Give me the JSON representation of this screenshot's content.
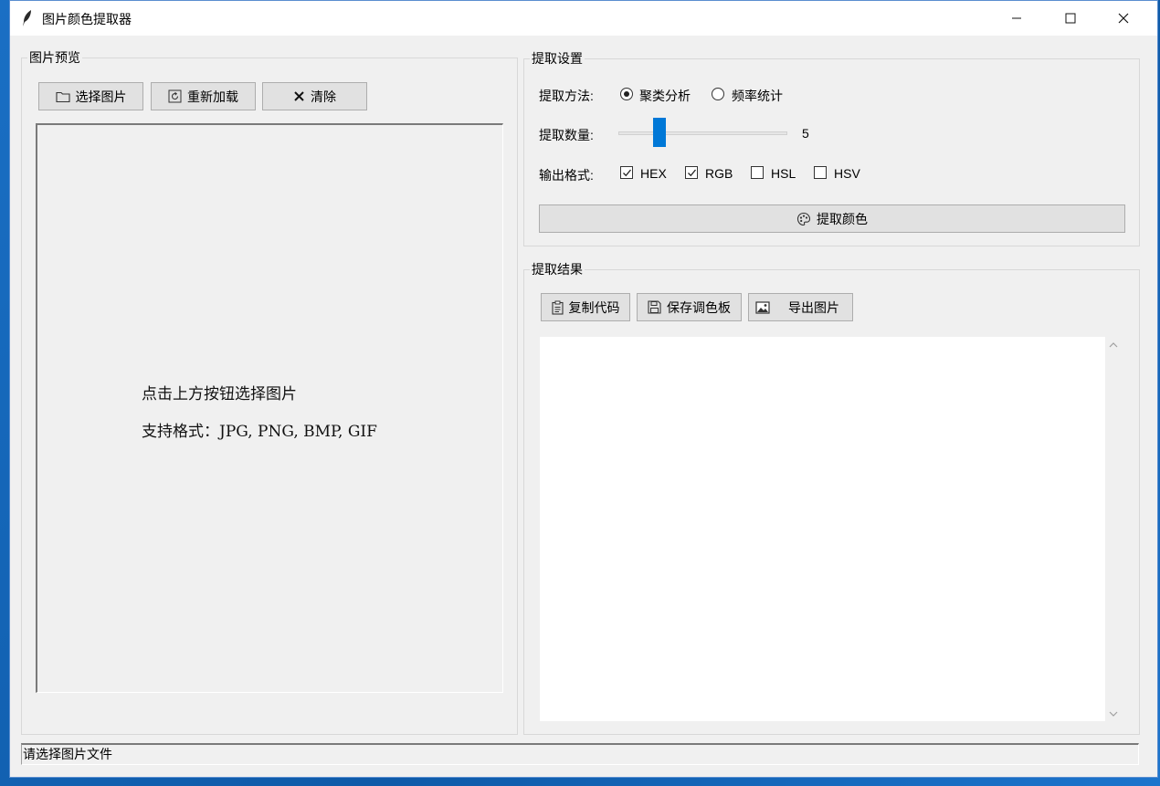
{
  "window": {
    "title": "图片颜色提取器",
    "controls": {
      "minimize": "—",
      "maximize": "☐",
      "close": "✕"
    }
  },
  "preview": {
    "legend": "图片预览",
    "buttons": {
      "select": {
        "label": "选择图片",
        "icon": "folder-icon"
      },
      "reload": {
        "label": "重新加载",
        "icon": "reload-icon"
      },
      "clear": {
        "label": "清除",
        "icon": "close-x-icon"
      }
    },
    "hint_line1": "点击上方按钮选择图片",
    "hint_line2": "支持格式：JPG, PNG, BMP, GIF"
  },
  "settings": {
    "legend": "提取设置",
    "method_label": "提取方法:",
    "methods": [
      {
        "label": "聚类分析",
        "selected": true
      },
      {
        "label": "频率统计",
        "selected": false
      }
    ],
    "count_label": "提取数量:",
    "count_value": "5",
    "count_fraction": 0.22,
    "format_label": "输出格式:",
    "formats": [
      {
        "label": "HEX",
        "checked": true
      },
      {
        "label": "RGB",
        "checked": true
      },
      {
        "label": "HSL",
        "checked": false
      },
      {
        "label": "HSV",
        "checked": false
      }
    ],
    "extract_button": {
      "label": "提取颜色",
      "icon": "palette-icon"
    },
    "accent_color": "#0078d7"
  },
  "results": {
    "legend": "提取结果",
    "buttons": {
      "copy": {
        "label": "复制代码",
        "icon": "clipboard-icon"
      },
      "save": {
        "label": "保存调色板",
        "icon": "save-icon"
      },
      "export": {
        "label": "导出图片",
        "icon": "image-icon"
      }
    }
  },
  "status": {
    "text": "请选择图片文件"
  }
}
